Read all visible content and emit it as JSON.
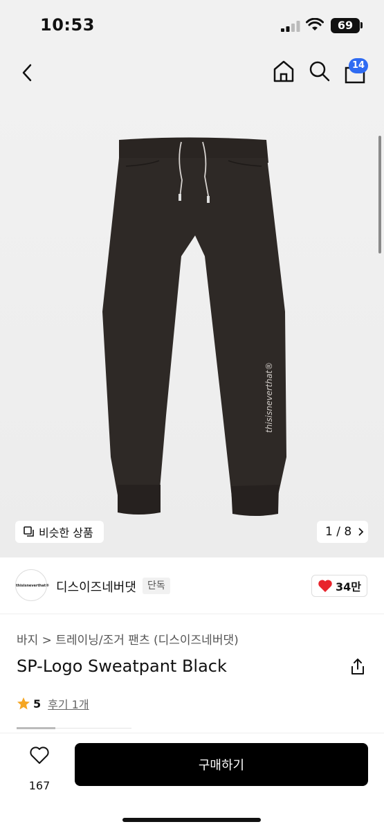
{
  "status_bar": {
    "time": "10:53",
    "battery": "69"
  },
  "header": {
    "cart_count": "14"
  },
  "gallery": {
    "similar_label": "비슷한 상품",
    "page_indicator": "1 / 8",
    "pants_text": "thisisneverthat®"
  },
  "brand": {
    "logo_text": "thisisneverthat®",
    "name": "디스이즈네버댓",
    "exclusive_badge": "단독",
    "likes": "34만"
  },
  "product": {
    "breadcrumb": "바지 > 트레이닝/조거 팬츠 (디스이즈네버댓)",
    "title": "SP-Logo Sweatpant Black",
    "rating": "5",
    "review_link": "후기 1개"
  },
  "bottom_bar": {
    "wishlist_count": "167",
    "buy_label": "구매하기"
  },
  "colors": {
    "badge_blue": "#2f6bf2",
    "heart_red": "#e8242c",
    "star_orange": "#f5a623",
    "buy_bg": "#000000"
  }
}
